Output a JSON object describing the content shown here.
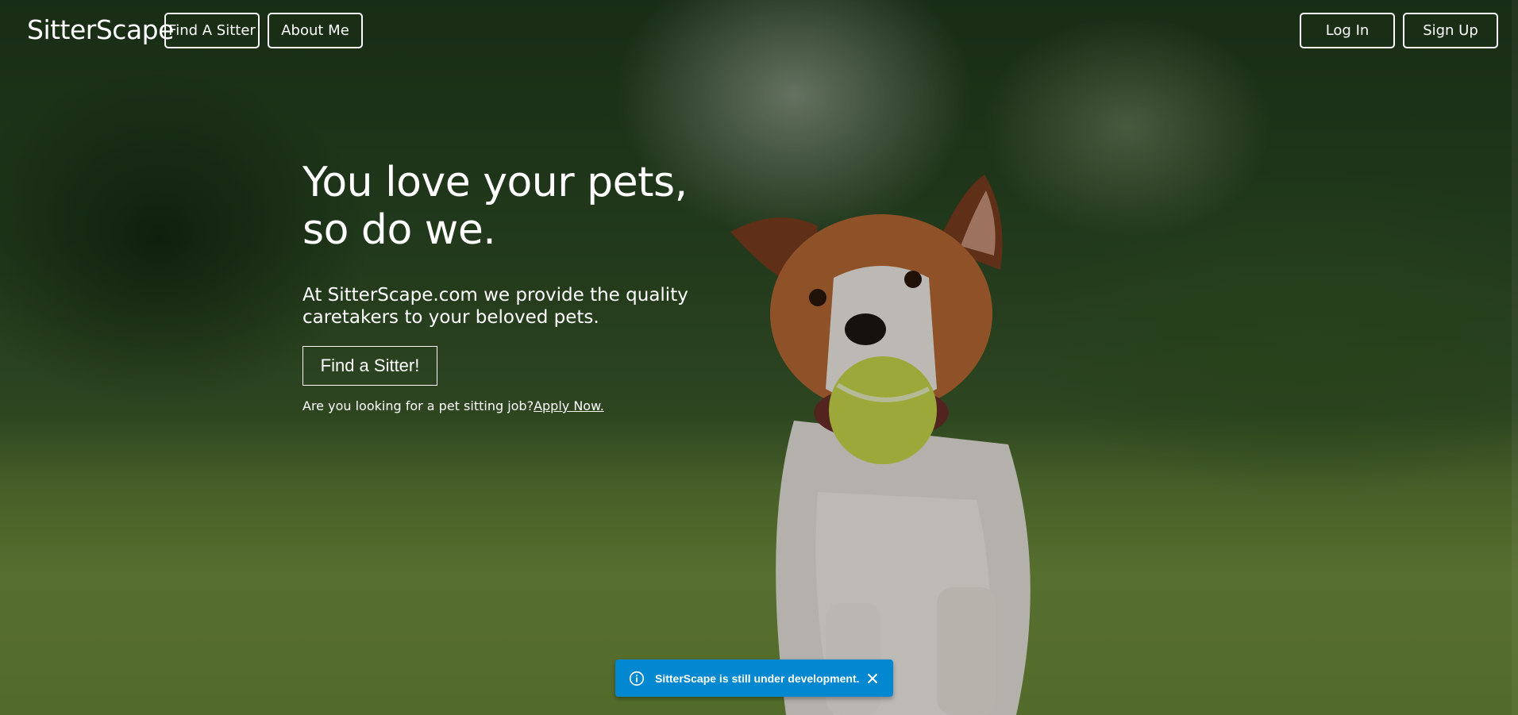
{
  "nav": {
    "brand": "SitterScape",
    "find_sitter": "Find A Sitter",
    "about_me": "About Me",
    "log_in": "Log In",
    "sign_up": "Sign Up"
  },
  "hero": {
    "headline_line1": "You love your pets,",
    "headline_line2": "so do we.",
    "lead": "At SitterScape.com we provide the quality caretakers to your beloved pets.",
    "cta": "Find a Sitter!",
    "job_prompt": "Are you looking for a pet sitting job?",
    "apply_link": "Apply Now."
  },
  "toast": {
    "message": "SitterScape is still under development.",
    "icon": "info-icon",
    "color": "#0288d1"
  }
}
